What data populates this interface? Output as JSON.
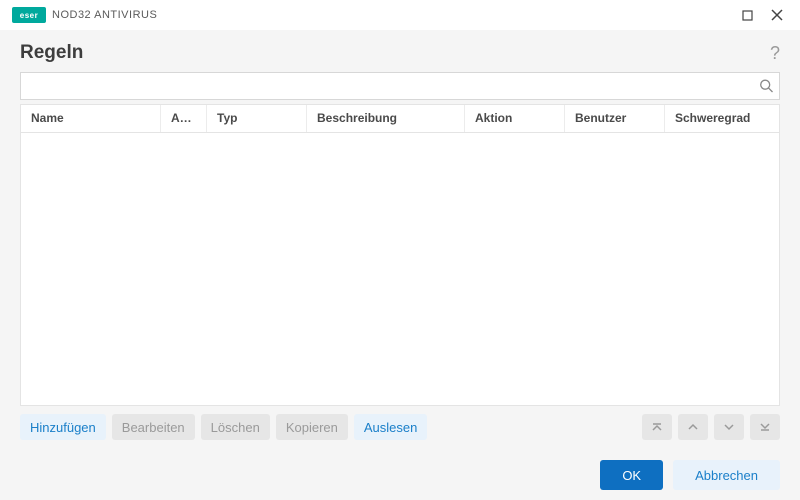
{
  "brand": {
    "logo_text": "eser",
    "product": "NOD32 ANTIVIRUS"
  },
  "header": {
    "title": "Regeln"
  },
  "search": {
    "value": "",
    "placeholder": ""
  },
  "columns": {
    "name": "Name",
    "active": "Aktivi...",
    "type": "Typ",
    "desc": "Beschreibung",
    "action": "Aktion",
    "user": "Benutzer",
    "severity": "Schweregrad"
  },
  "rows": [],
  "toolbar": {
    "add": "Hinzufügen",
    "edit": "Bearbeiten",
    "delete": "Löschen",
    "copy": "Kopieren",
    "read": "Auslesen"
  },
  "footer": {
    "ok": "OK",
    "cancel": "Abbrechen"
  }
}
